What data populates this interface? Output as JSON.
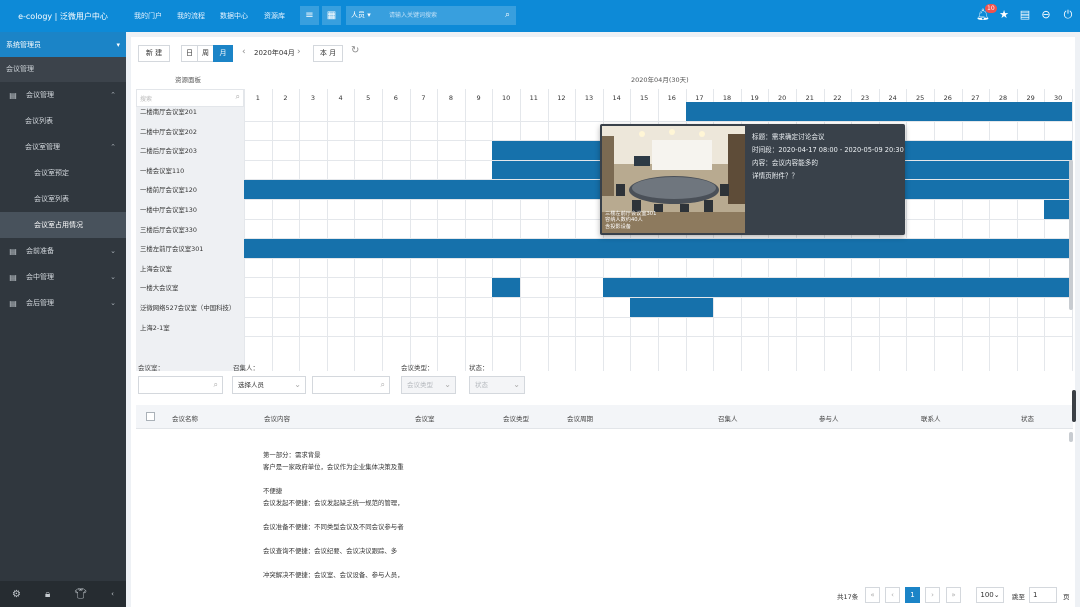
{
  "topbar": {
    "logo": "e-cology | 泛微用户中心",
    "nav": [
      "我的门户",
      "我的流程",
      "数据中心",
      "资源库"
    ],
    "search_type": "人员",
    "search_placeholder": "请输入关键词搜索",
    "notification_count": "10",
    "accent_color": "#0d8ad7"
  },
  "sidebar": {
    "user": "系统管理员",
    "module_title": "会议管理",
    "items": [
      {
        "label": "会议管理",
        "level": 1,
        "icon": "doc-icon",
        "arrow": "⌃"
      },
      {
        "label": "会议列表",
        "level": 2
      },
      {
        "label": "会议室管理",
        "level": 2,
        "arrow": "⌃"
      },
      {
        "label": "会议室预定",
        "level": 3
      },
      {
        "label": "会议室列表",
        "level": 3
      },
      {
        "label": "会议室占用情况",
        "level": 3,
        "active": true
      },
      {
        "label": "会前准备",
        "level": 1,
        "icon": "doc-icon",
        "arrow": "⌄"
      },
      {
        "label": "会中管理",
        "level": 1,
        "icon": "doc-icon",
        "arrow": "⌄"
      },
      {
        "label": "会后管理",
        "level": 1,
        "icon": "doc-icon",
        "arrow": "⌄"
      }
    ]
  },
  "toolbar": {
    "new_label": "新 建",
    "day_label": "日",
    "week_label": "周",
    "month_label": "月",
    "period": "2020年04月",
    "this_month_label": "本 月"
  },
  "calendar": {
    "resource_header": "资源面板",
    "month_header": "2020年04月(30天)",
    "search_placeholder": "搜索",
    "days": [
      "1",
      "2",
      "3",
      "4",
      "5",
      "6",
      "7",
      "8",
      "9",
      "10",
      "11",
      "12",
      "13",
      "14",
      "15",
      "16",
      "17",
      "18",
      "19",
      "20",
      "21",
      "22",
      "23",
      "24",
      "25",
      "26",
      "27",
      "28",
      "29",
      "30"
    ],
    "rooms": [
      {
        "name": "二楼南厅会议室201",
        "bookings": [
          [
            17,
            30
          ]
        ]
      },
      {
        "name": "二楼中厅会议室202",
        "bookings": []
      },
      {
        "name": "二楼后厅会议室203",
        "bookings": [
          [
            10,
            30
          ]
        ]
      },
      {
        "name": "一楼会议室110",
        "bookings": [
          [
            10,
            30
          ]
        ]
      },
      {
        "name": "一楼前厅会议室120",
        "bookings": [
          [
            1,
            30
          ]
        ]
      },
      {
        "name": "一楼中厅会议室130",
        "bookings": [
          [
            30,
            30
          ]
        ]
      },
      {
        "name": "三楼后厅会议室330",
        "bookings": []
      },
      {
        "name": "三楼左前厅会议室301",
        "bookings": [
          [
            1,
            30
          ]
        ]
      },
      {
        "name": "上海会议室",
        "bookings": []
      },
      {
        "name": "一楼大会议室",
        "bookings": [
          [
            10,
            10
          ],
          [
            14,
            30
          ]
        ]
      },
      {
        "name": "泛微网络527会议室（中国科技）",
        "bookings": [
          [
            15,
            17
          ]
        ]
      },
      {
        "name": "上海2-1室",
        "bookings": []
      }
    ]
  },
  "tooltip": {
    "title": "标题：需求确定讨论会议",
    "time": "时间段：2020-04-17 08:00 - 2020-05-09 20:30",
    "content": "内容：会议内容能多的",
    "attachment": "详情页附件？？",
    "image_caption": "三楼左前厅会议室301\n容纳人数约40人\n含投影设备"
  },
  "filters": {
    "room_label": "会议室：",
    "convener_label": "召集人：",
    "convener_value": "选择人员",
    "type_label": "会议类型：",
    "type_value": "会议类型",
    "status_label": "状态：",
    "status_value": "状态"
  },
  "table": {
    "headers": [
      "会议名称",
      "会议内容",
      "会议室",
      "会议类型",
      "会议周期",
      "召集人",
      "参与人",
      "联系人",
      "状态"
    ]
  },
  "content_lines": [
    "第一部分：需求背景",
    "客户是一家政府单位，会议作为企业集体决策及重",
    "",
    "不便捷",
    "会议发起不便捷：会议发起缺乏统一规范的管理，",
    "",
    "会议准备不便捷：不同类型会议及不同会议参与者",
    "",
    "会议查询不便捷：会议纪要、会议决议跟踪、多",
    "",
    "冲突解决不便捷：会议室、会议设备、参与人员，"
  ],
  "pagination": {
    "total": "共17条",
    "current": "1",
    "page_size": "100",
    "goto_label": "跳至",
    "goto_value": "1",
    "page_unit": "页"
  }
}
